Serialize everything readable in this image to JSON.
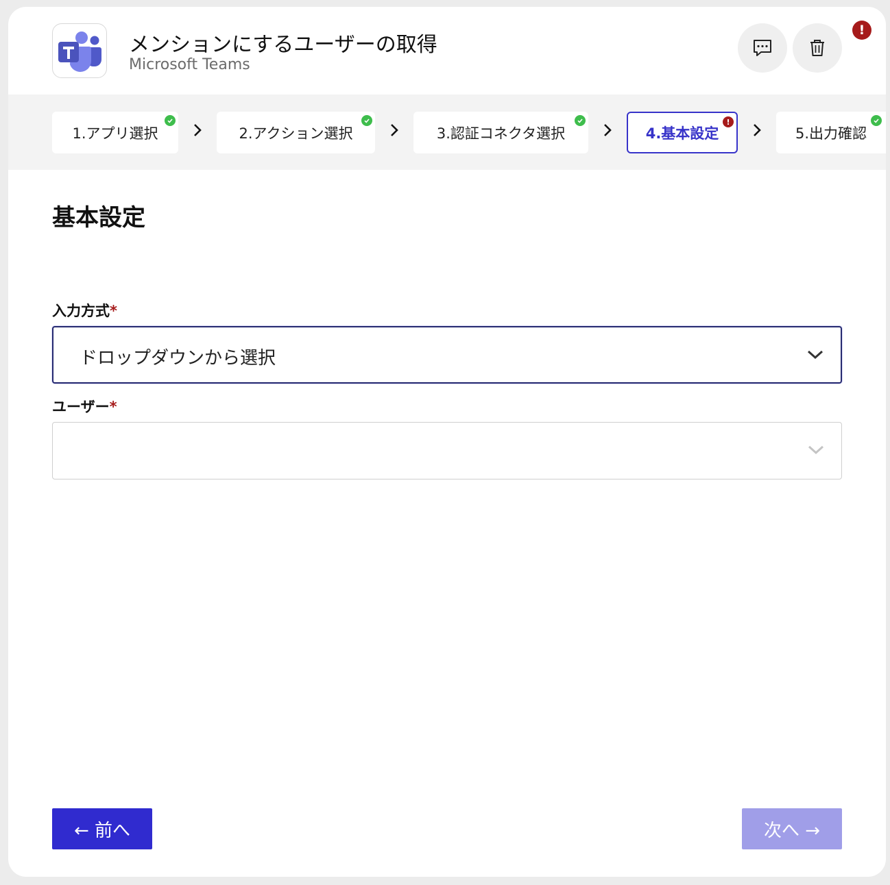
{
  "header": {
    "title": "メンションにするユーザーの取得",
    "subtitle": "Microsoft Teams",
    "app_icon": "microsoft-teams-icon",
    "alert_badge": "!"
  },
  "steps": [
    {
      "label": "1.アプリ選択",
      "status": "complete"
    },
    {
      "label": "2.アクション選択",
      "status": "complete"
    },
    {
      "label": "3.認証コネクタ選択",
      "status": "complete"
    },
    {
      "label": "4.基本設定",
      "status": "error"
    },
    {
      "label": "5.出力確認",
      "status": "complete"
    }
  ],
  "step_error_mark": "!",
  "main": {
    "section_title": "基本設定",
    "fields": [
      {
        "label": "入力方式",
        "required_mark": "*",
        "value": "ドロップダウンから選択"
      },
      {
        "label": "ユーザー",
        "required_mark": "*",
        "value": ""
      }
    ]
  },
  "footer": {
    "prev_label": "← 前へ",
    "next_label": "次へ →"
  },
  "colors": {
    "accent": "#302bcf",
    "accent_disabled": "#a09ee8",
    "error": "#a61b1b",
    "success": "#3ebd4c"
  }
}
